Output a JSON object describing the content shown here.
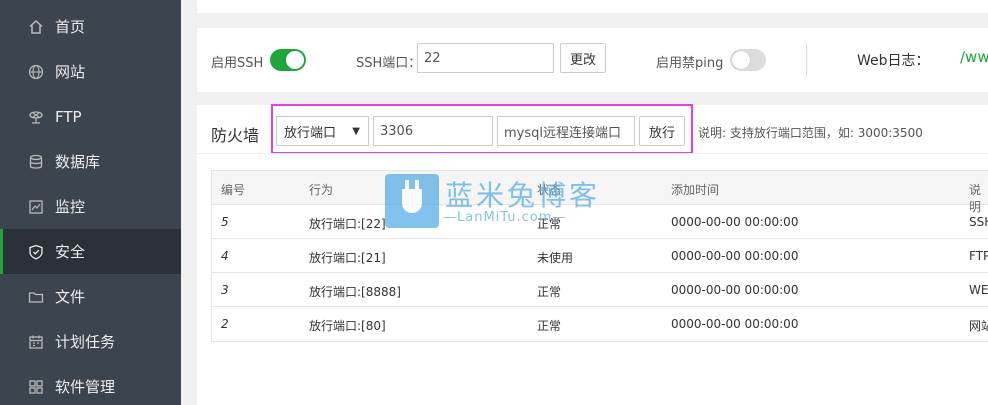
{
  "sidebar": {
    "items": [
      {
        "label": "首页",
        "icon": "home-icon"
      },
      {
        "label": "网站",
        "icon": "globe-icon"
      },
      {
        "label": "FTP",
        "icon": "ftp-icon"
      },
      {
        "label": "数据库",
        "icon": "database-icon"
      },
      {
        "label": "监控",
        "icon": "monitor-icon"
      },
      {
        "label": "安全",
        "icon": "shield-icon",
        "active": true
      },
      {
        "label": "文件",
        "icon": "folder-icon"
      },
      {
        "label": "计划任务",
        "icon": "calendar-icon"
      },
      {
        "label": "软件管理",
        "icon": "apps-icon"
      }
    ]
  },
  "ssh": {
    "enable_label": "启用SSH",
    "enabled": true,
    "port_label": "SSH端口：",
    "port_value": "22",
    "change_button": "更改",
    "ping_label": "启用禁ping",
    "ping_enabled": false,
    "weblog_label": "Web日志：",
    "weblog_value": "/www"
  },
  "firewall": {
    "title": "防火墙",
    "type_select": "放行端口",
    "port_value": "3306",
    "remark_value": "mysql远程连接端口",
    "allow_button": "放行",
    "note": "说明: 支持放行端口范围，如: 3000:3500",
    "columns": [
      "编号",
      "行为",
      "状态",
      "添加时间",
      "说明"
    ],
    "rows": [
      {
        "id": "5",
        "action": "放行端口:[22]",
        "status": "正常",
        "time": "0000-00-00 00:00:00",
        "note": "SSH"
      },
      {
        "id": "4",
        "action": "放行端口:[21]",
        "status": "未使用",
        "time": "0000-00-00 00:00:00",
        "note": "FTP"
      },
      {
        "id": "3",
        "action": "放行端口:[8888]",
        "status": "正常",
        "time": "0000-00-00 00:00:00",
        "note": "WE"
      },
      {
        "id": "2",
        "action": "放行端口:[80]",
        "status": "正常",
        "time": "0000-00-00 00:00:00",
        "note": "网站"
      }
    ]
  },
  "watermark": {
    "title": "蓝米兔博客",
    "subtitle": "—LanMiTu.com—"
  },
  "colors": {
    "sidebar_bg": "#3c444d",
    "sidebar_active_bg": "#2a3139",
    "accent_green": "#20a53a",
    "highlight_magenta": "#e33fe3"
  }
}
